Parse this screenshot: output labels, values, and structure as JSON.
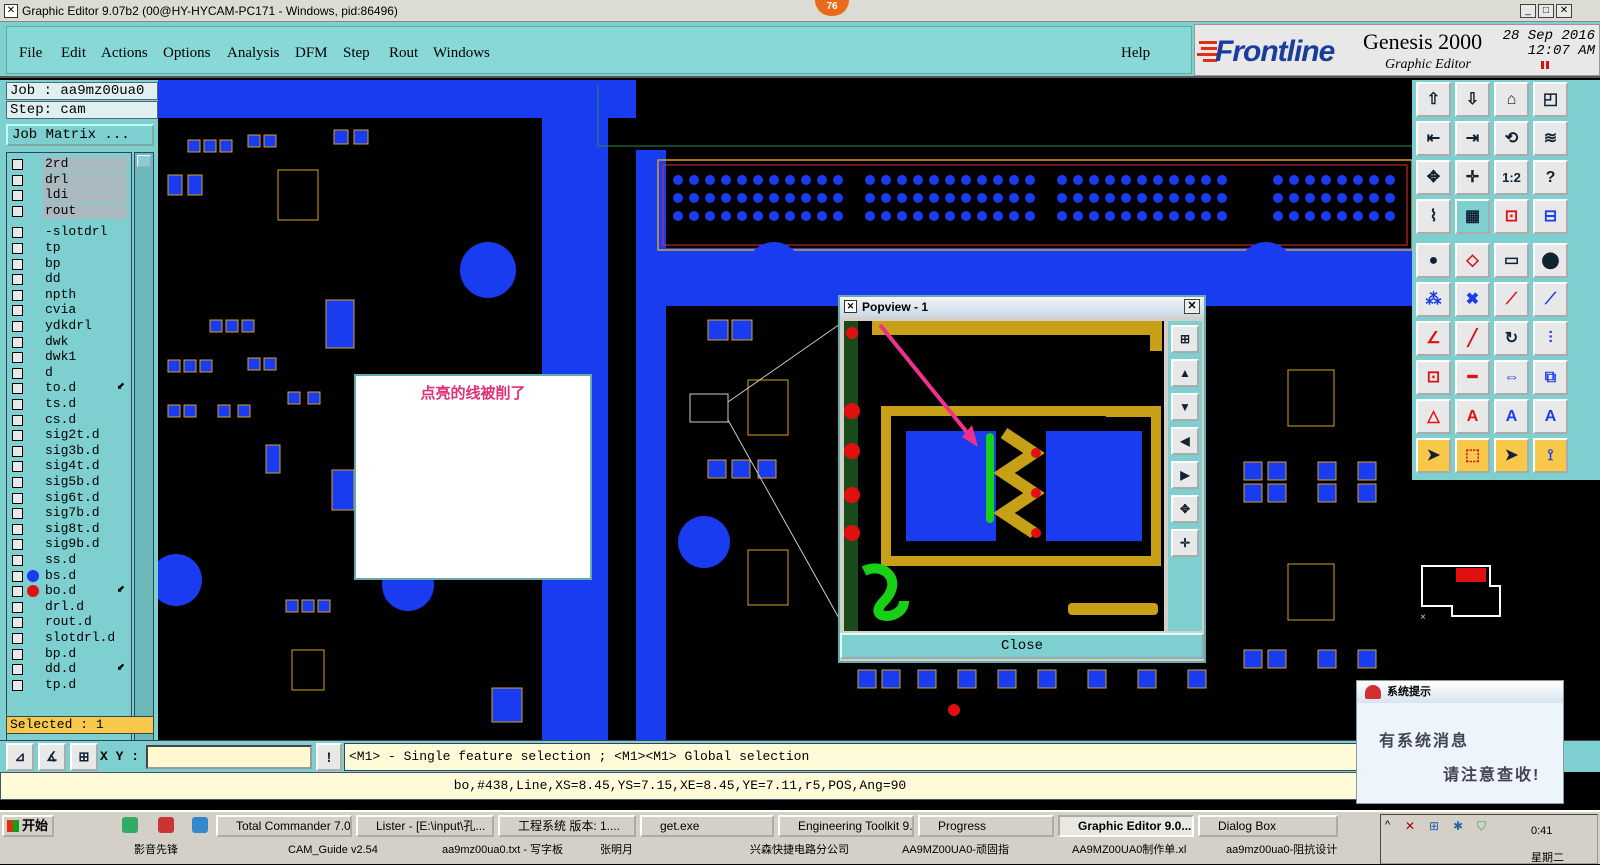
{
  "window": {
    "title": "Graphic Editor 9.07b2 (00@HY-HYCAM-PC171 - Windows, pid:86496)",
    "badge": "76"
  },
  "menu": {
    "items": [
      "File",
      "Edit",
      "Actions",
      "Options",
      "Analysis",
      "DFM",
      "Step",
      "Rout",
      "Windows"
    ],
    "help": "Help"
  },
  "logo": {
    "brand": "Frontline",
    "product": "Genesis 2000",
    "subtitle": "Graphic Editor",
    "date": "28 Sep 2016",
    "time": "12:07 AM"
  },
  "job": {
    "job": "Job : aa9mz00ua0",
    "step": "Step: cam",
    "matrix_button": "Job Matrix ..."
  },
  "layers": [
    {
      "name": "2rd",
      "dot": ""
    },
    {
      "name": "drl",
      "dot": ""
    },
    {
      "name": "ldi",
      "dot": ""
    },
    {
      "name": "rout",
      "dot": ""
    },
    {
      "name": "-slotdrl",
      "dot": ""
    },
    {
      "name": "tp",
      "dot": ""
    },
    {
      "name": "bp",
      "dot": ""
    },
    {
      "name": "dd",
      "dot": ""
    },
    {
      "name": "npth",
      "dot": ""
    },
    {
      "name": "cvia",
      "dot": ""
    },
    {
      "name": "ydkdrl",
      "dot": ""
    },
    {
      "name": "dwk",
      "dot": ""
    },
    {
      "name": "dwk1",
      "dot": ""
    },
    {
      "name": "d",
      "dot": ""
    },
    {
      "name": "to.d",
      "dot": "",
      "mark": "⬋"
    },
    {
      "name": "ts.d",
      "dot": ""
    },
    {
      "name": "cs.d",
      "dot": ""
    },
    {
      "name": "sig2t.d",
      "dot": ""
    },
    {
      "name": "sig3b.d",
      "dot": ""
    },
    {
      "name": "sig4t.d",
      "dot": ""
    },
    {
      "name": "sig5b.d",
      "dot": ""
    },
    {
      "name": "sig6t.d",
      "dot": ""
    },
    {
      "name": "sig7b.d",
      "dot": ""
    },
    {
      "name": "sig8t.d",
      "dot": ""
    },
    {
      "name": "sig9b.d",
      "dot": ""
    },
    {
      "name": "ss.d",
      "dot": ""
    },
    {
      "name": "bs.d",
      "dot": "#1a3cf0"
    },
    {
      "name": "bo.d",
      "dot": "#e01010",
      "mark": "⬋"
    },
    {
      "name": "drl.d",
      "dot": ""
    },
    {
      "name": "rout.d",
      "dot": ""
    },
    {
      "name": "slotdrl.d",
      "dot": ""
    },
    {
      "name": "bp.d",
      "dot": ""
    },
    {
      "name": "dd.d",
      "dot": "",
      "mark": "⬋"
    },
    {
      "name": "tp.d",
      "dot": ""
    }
  ],
  "selected": "Selected : 1",
  "popview": {
    "title": "Popview - 1",
    "close_label": "Close"
  },
  "note": {
    "text": "点亮的线被削了"
  },
  "bottom": {
    "xy_label": "X Y :",
    "xy_value": "",
    "bang": "!",
    "hint": "<M1> - Single feature selection ; <M1><M1> Global selection"
  },
  "status": "bo,#438,Line,XS=8.45,YS=7.15,XE=8.45,YE=7.11,r5,POS,Ang=90",
  "sysmsg": {
    "title": "系统提示",
    "line1": "有系统消息",
    "line2": "请注意查收!"
  },
  "taskbar": {
    "start": "开始",
    "row1": [
      "Total Commander 7.0...",
      "Lister - [E:\\input\\孔...",
      "工程系统 版本: 1....",
      "get.exe",
      "Engineering Toolkit 9...",
      "Progress",
      "Graphic Editor 9.0...",
      "Dialog Box"
    ],
    "row2": [
      "影音先锋",
      "CAM_Guide v2.54",
      "aa9mz00ua0.txt - 写字板",
      "张明月",
      "兴森快捷电路分公司",
      "AA9MZ00UA0-顽固指",
      "AA9MZ00UA0制作单.xl",
      "aa9mz00ua0-阻抗设计"
    ],
    "clock": "0:41",
    "weekday": "星期二"
  },
  "colors": {
    "panel": "#7ecfcf",
    "copper": "#1a3cf0",
    "outline": "#d8a020",
    "accent": "#e8307a"
  }
}
